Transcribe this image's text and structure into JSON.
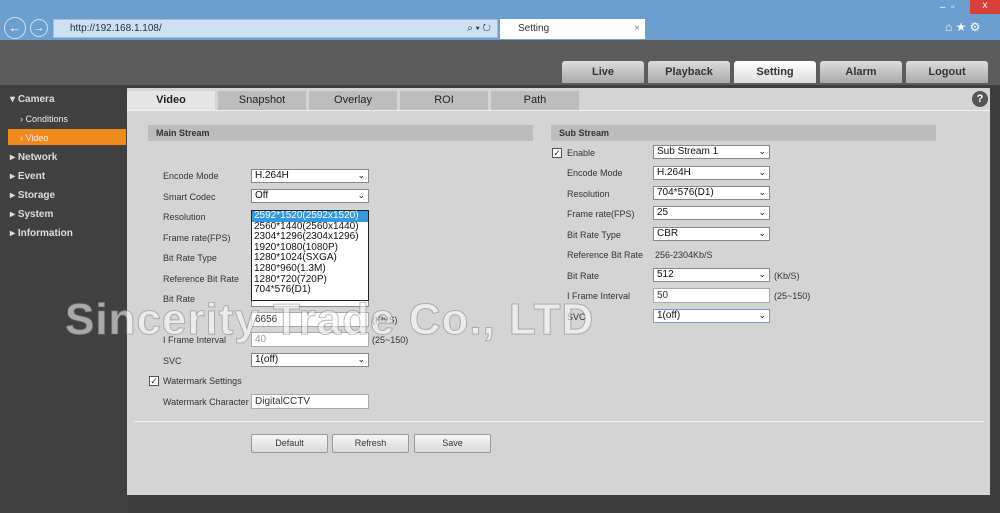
{
  "browser": {
    "url": "http://192.168.1.108/",
    "tab_title": "Setting"
  },
  "nav": [
    "Live",
    "Playback",
    "Setting",
    "Alarm",
    "Logout"
  ],
  "sidebar": {
    "groups": [
      {
        "label": "Camera",
        "items": [
          "Conditions",
          "Video"
        ]
      },
      {
        "label": "Network"
      },
      {
        "label": "Event"
      },
      {
        "label": "Storage"
      },
      {
        "label": "System"
      },
      {
        "label": "Information"
      }
    ]
  },
  "tabs": [
    "Video",
    "Snapshot",
    "Overlay",
    "ROI",
    "Path"
  ],
  "main_stream": {
    "title": "Main Stream",
    "labels": [
      "Encode Mode",
      "Smart Codec",
      "Resolution",
      "Frame rate(FPS)",
      "Bit Rate Type",
      "Reference Bit Rate",
      "Bit Rate",
      "I Frame Interval",
      "SVC"
    ],
    "encode_mode": "H.264H",
    "smart_codec": "Off",
    "bit_rate": "6656",
    "bit_rate_unit": "(Kb/S)",
    "i_frame": "40",
    "i_frame_range": "(25~150)",
    "svc": "1(off)",
    "resolution_options": [
      "2592*1520(2592x1520)",
      "2560*1440(2560x1440)",
      "2304*1296(2304x1296)",
      "1920*1080(1080P)",
      "1280*1024(SXGA)",
      "1280*960(1.3M)",
      "1280*720(720P)",
      "704*576(D1)"
    ],
    "watermark_label": "Watermark Settings",
    "watermark_checked": true,
    "watermark_char_label": "Watermark Character",
    "watermark_char": "DigitalCCTV"
  },
  "sub_stream": {
    "title": "Sub Stream",
    "enable_label": "Enable",
    "enabled": true,
    "stream": "Sub Stream 1",
    "labels": [
      "Encode Mode",
      "Resolution",
      "Frame rate(FPS)",
      "Bit Rate Type",
      "Reference Bit Rate",
      "Bit Rate",
      "I Frame Interval",
      "SVC"
    ],
    "encode_mode": "H.264H",
    "resolution": "704*576(D1)",
    "fps": "25",
    "bit_rate_type": "CBR",
    "ref_bit_rate": "256-2304Kb/S",
    "bit_rate": "512",
    "bit_rate_unit": "(Kb/S)",
    "i_frame": "50",
    "i_frame_range": "(25~150)",
    "svc": "1(off)"
  },
  "buttons": {
    "default": "Default",
    "refresh": "Refresh",
    "save": "Save"
  },
  "watermark": "Sincerity Trade Co., LTD"
}
